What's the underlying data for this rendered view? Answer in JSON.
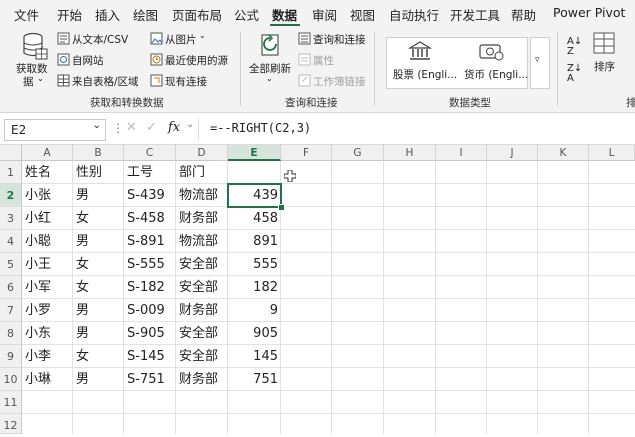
{
  "menu": {
    "items": [
      "文件",
      "开始",
      "插入",
      "绘图",
      "页面布局",
      "公式",
      "数据",
      "审阅",
      "视图",
      "自动执行",
      "开发工具",
      "帮助",
      "Power Pivot"
    ],
    "active_index": 6
  },
  "ribbon": {
    "get_data": {
      "line1": "获取数",
      "line2": "据"
    },
    "from_text_csv": "从文本/CSV",
    "from_web": "自网站",
    "from_table": "来自表格/区域",
    "from_picture": "从图片",
    "recent_sources": "最近使用的源",
    "existing_connections": "现有连接",
    "group_get_transform": "获取和转换数据",
    "refresh_all": "全部刷新",
    "queries_connections": "查询和连接",
    "properties": "属性",
    "workbook_links": "工作簿链接",
    "group_queries": "查询和连接",
    "stocks": "股票 (Engli...",
    "currencies": "货币 (Engli...",
    "group_data_types": "数据类型",
    "sort": "排序",
    "group_cut": "排"
  },
  "formula_bar": {
    "name_box": "E2",
    "fx_symbol": "fx",
    "formula": "=--RIGHT(C2,3)"
  },
  "columns": [
    "A",
    "B",
    "C",
    "D",
    "E",
    "F",
    "G",
    "H",
    "I",
    "J",
    "K",
    "L"
  ],
  "selected_column": "E",
  "rows": [
    "1",
    "2",
    "3",
    "4",
    "5",
    "6",
    "7",
    "8",
    "9",
    "10",
    "11",
    "12"
  ],
  "selected_row": "2",
  "table": {
    "header": [
      "姓名",
      "性别",
      "工号",
      "部门"
    ],
    "data": [
      [
        "小张",
        "男",
        "S-439",
        "物流部",
        "439"
      ],
      [
        "小红",
        "女",
        "S-458",
        "财务部",
        "458"
      ],
      [
        "小聪",
        "男",
        "S-891",
        "物流部",
        "891"
      ],
      [
        "小王",
        "女",
        "S-555",
        "安全部",
        "555"
      ],
      [
        "小军",
        "女",
        "S-182",
        "安全部",
        "182"
      ],
      [
        "小罗",
        "男",
        "S-009",
        "财务部",
        "9"
      ],
      [
        "小东",
        "男",
        "S-905",
        "安全部",
        "905"
      ],
      [
        "小李",
        "女",
        "S-145",
        "安全部",
        "145"
      ],
      [
        "小琳",
        "男",
        "S-751",
        "财务部",
        "751"
      ]
    ]
  },
  "colors": {
    "accent": "#217346"
  }
}
